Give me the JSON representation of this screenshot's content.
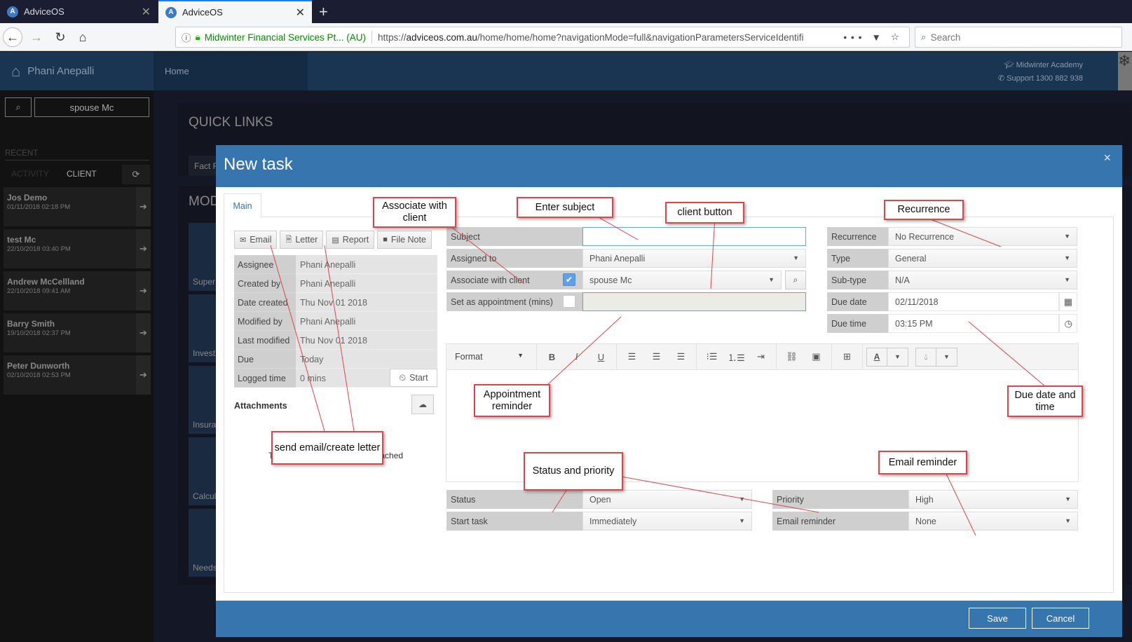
{
  "browser": {
    "tabs": [
      {
        "title": "AdviceOS",
        "active": false
      },
      {
        "title": "AdviceOS",
        "active": true
      }
    ],
    "new_tab_label": "+",
    "url_org": "Midwinter Financial Services Pt... (AU)",
    "url_prefix": "https://",
    "url_domain": "adviceos.com.au",
    "url_path": "/home/home/home?navigationMode=full&navigationParametersServiceIdentifi",
    "search_placeholder": "Search"
  },
  "app_header": {
    "user": "Phani Anepalli",
    "nav_home": "Home",
    "academy": "Midwinter Academy",
    "support": "Support 1300 882 938"
  },
  "sidebar": {
    "search_value": "spouse Mc",
    "recent_label": "RECENT",
    "tab_activity": "ACTIVITY",
    "tab_client": "CLIENT",
    "items": [
      {
        "name": "Jos Demo",
        "date": "01/11/2018 02:18 PM"
      },
      {
        "name": "test Mc",
        "date": "22/10/2018 03:40 PM"
      },
      {
        "name": "Andrew McCellland",
        "date": "22/10/2018 09:41 AM"
      },
      {
        "name": "Barry Smith",
        "date": "19/10/2018 02:37 PM"
      },
      {
        "name": "Peter Dunworth",
        "date": "02/10/2018 02:53 PM"
      }
    ]
  },
  "background": {
    "quick_links_title": "QUICK LINKS",
    "quick_link_1": "Fact F",
    "modules_title": "MOD",
    "tiles": [
      "Super",
      "Invest",
      "Insura Comp",
      "Calcul",
      "Needs"
    ]
  },
  "modal": {
    "title": "New task",
    "close": "×",
    "tab_main": "Main",
    "actions": {
      "email": "Email",
      "letter": "Letter",
      "report": "Report",
      "file_note": "File Note"
    },
    "info": [
      {
        "label": "Assignee",
        "value": "Phani Anepalli"
      },
      {
        "label": "Created by",
        "value": "Phani Anepalli"
      },
      {
        "label": "Date created",
        "value": "Thu Nov 01 2018"
      },
      {
        "label": "Modified by",
        "value": "Phani Anepalli"
      },
      {
        "label": "Last modified",
        "value": "Thu Nov 01 2018"
      },
      {
        "label": "Due",
        "value": "Today"
      },
      {
        "label": "Logged time",
        "value": "0 mins"
      }
    ],
    "start_label": "Start",
    "attachments_label": "Attachments",
    "no_files": "There are currently no files attached",
    "form": {
      "subject_label": "Subject",
      "subject_value": "",
      "assigned_label": "Assigned to",
      "assigned_value": "Phani Anepalli",
      "associate_label": "Associate with client",
      "associate_checked": true,
      "client_value": "spouse Mc",
      "appointment_label": "Set as appointment (mins)",
      "appointment_checked": false,
      "appointment_value": "",
      "recurrence_label": "Recurrence",
      "recurrence_value": "No Recurrence",
      "type_label": "Type",
      "type_value": "General",
      "subtype_label": "Sub-type",
      "subtype_value": "N/A",
      "due_date_label": "Due date",
      "due_date_value": "02/11/2018",
      "due_time_label": "Due time",
      "due_time_value": "03:15 PM",
      "status_label": "Status",
      "status_value": "Open",
      "start_task_label": "Start task",
      "start_task_value": "Immediately",
      "priority_label": "Priority",
      "priority_value": "High",
      "email_reminder_label": "Email reminder",
      "email_reminder_value": "None"
    },
    "editor": {
      "format_label": "Format"
    },
    "save": "Save",
    "cancel": "Cancel"
  },
  "annotations": {
    "associate": "Associate with client",
    "subject": "Enter subject",
    "client_button": "client button",
    "recurrence": "Recurrence",
    "appointment": "Appointment reminder",
    "due": "Due date and time",
    "send": "send email/create letter",
    "status": "Status and priority",
    "email_reminder": "Email reminder"
  },
  "colors": {
    "modal_header": "#3675ad",
    "annotation_border": "#d9474d",
    "app_header": "#1a3551"
  }
}
